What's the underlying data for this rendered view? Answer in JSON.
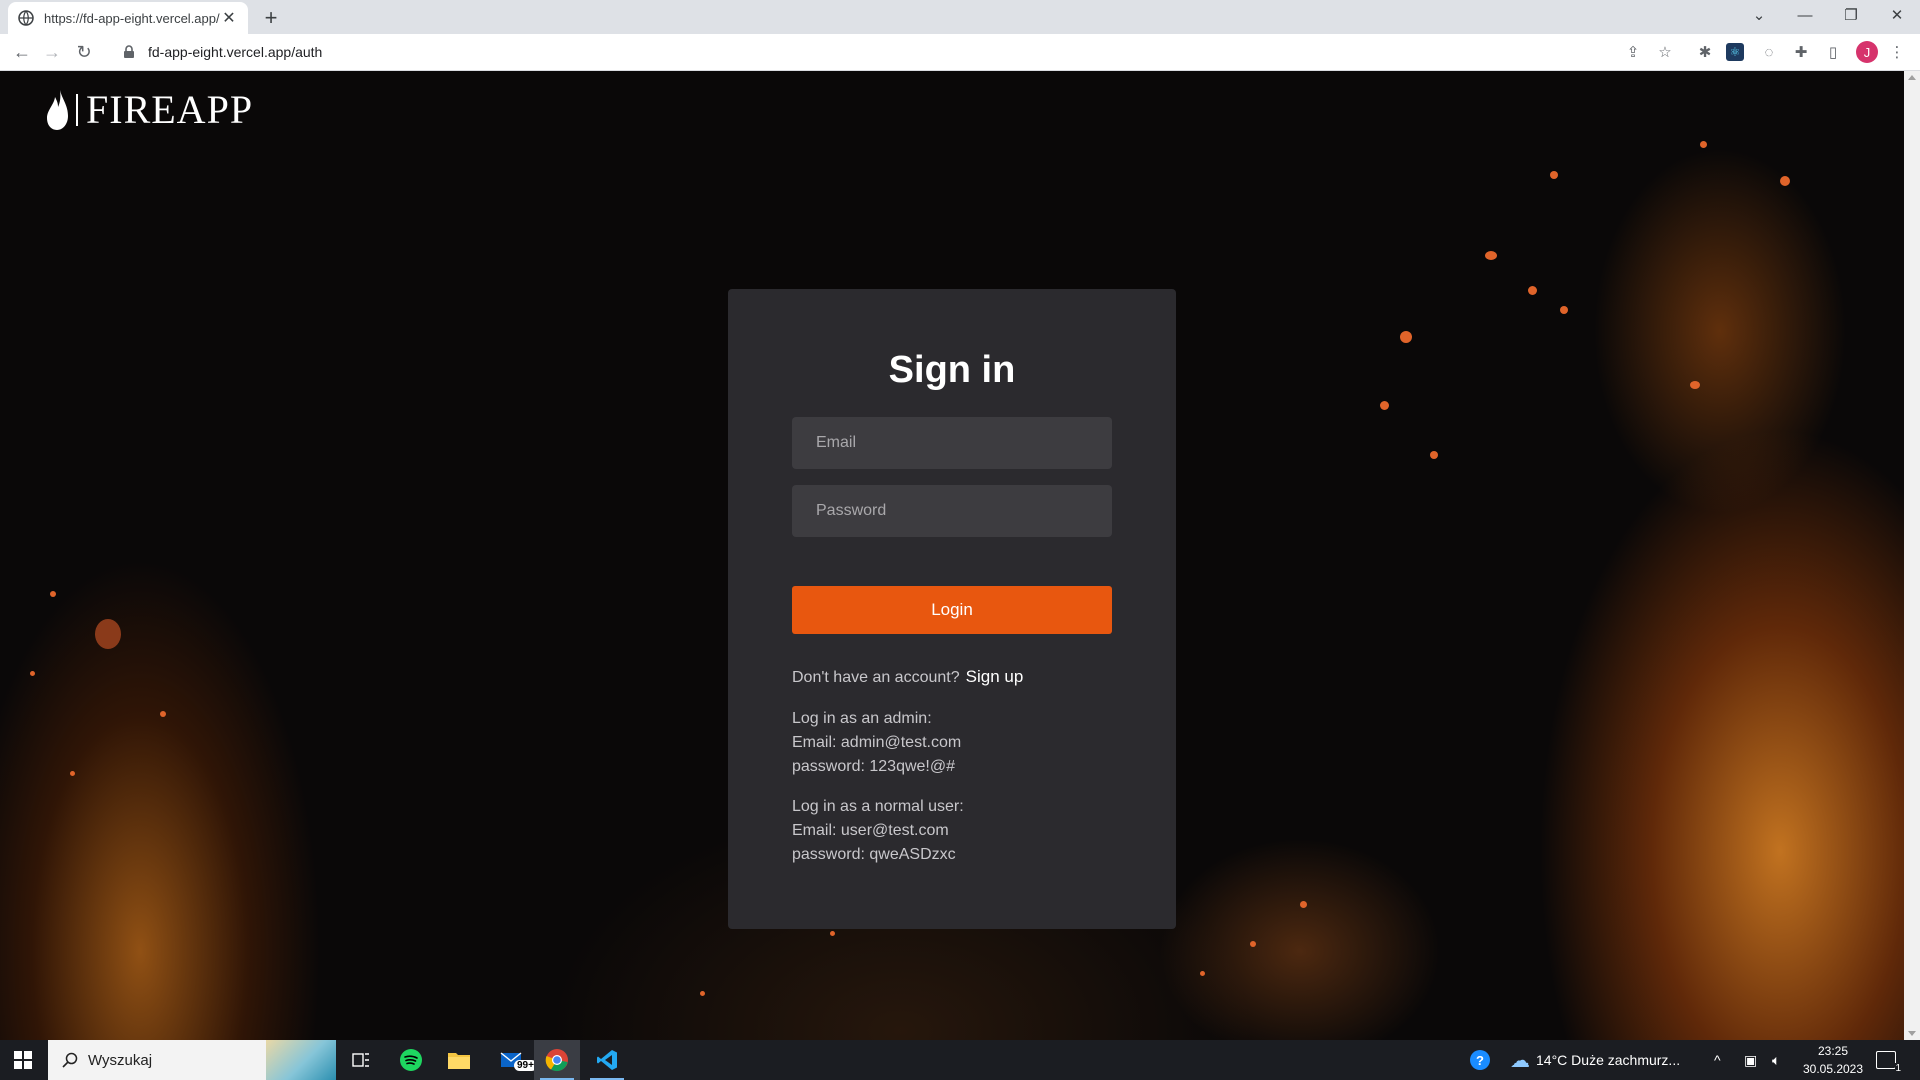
{
  "browser": {
    "tab_title": "https://fd-app-eight.vercel.app/a",
    "url": "fd-app-eight.vercel.app/auth",
    "profile_initial": "J"
  },
  "page": {
    "logo_text": "FIREAPP",
    "heading": "Sign in",
    "email_placeholder": "Email",
    "password_placeholder": "Password",
    "login_label": "Login",
    "no_account_text": "Don't have an account?",
    "signup_label": "Sign up",
    "admin_hint": {
      "title": "Log in as an admin:",
      "email": "Email: admin@test.com",
      "password": "password: 123qwe!@#"
    },
    "user_hint": {
      "title": "Log in as a normal user:",
      "email": "Email: user@test.com",
      "password": "password: qweASDzxc"
    }
  },
  "taskbar": {
    "search_text": "Wyszukaj",
    "mail_badge": "99+",
    "weather": "14°C  Duże zachmurz...",
    "time": "23:25",
    "date": "30.05.2023",
    "notification_count": "1"
  },
  "colors": {
    "accent": "#e8570f",
    "card": "#2b2a2e",
    "field": "#3d3c40"
  }
}
